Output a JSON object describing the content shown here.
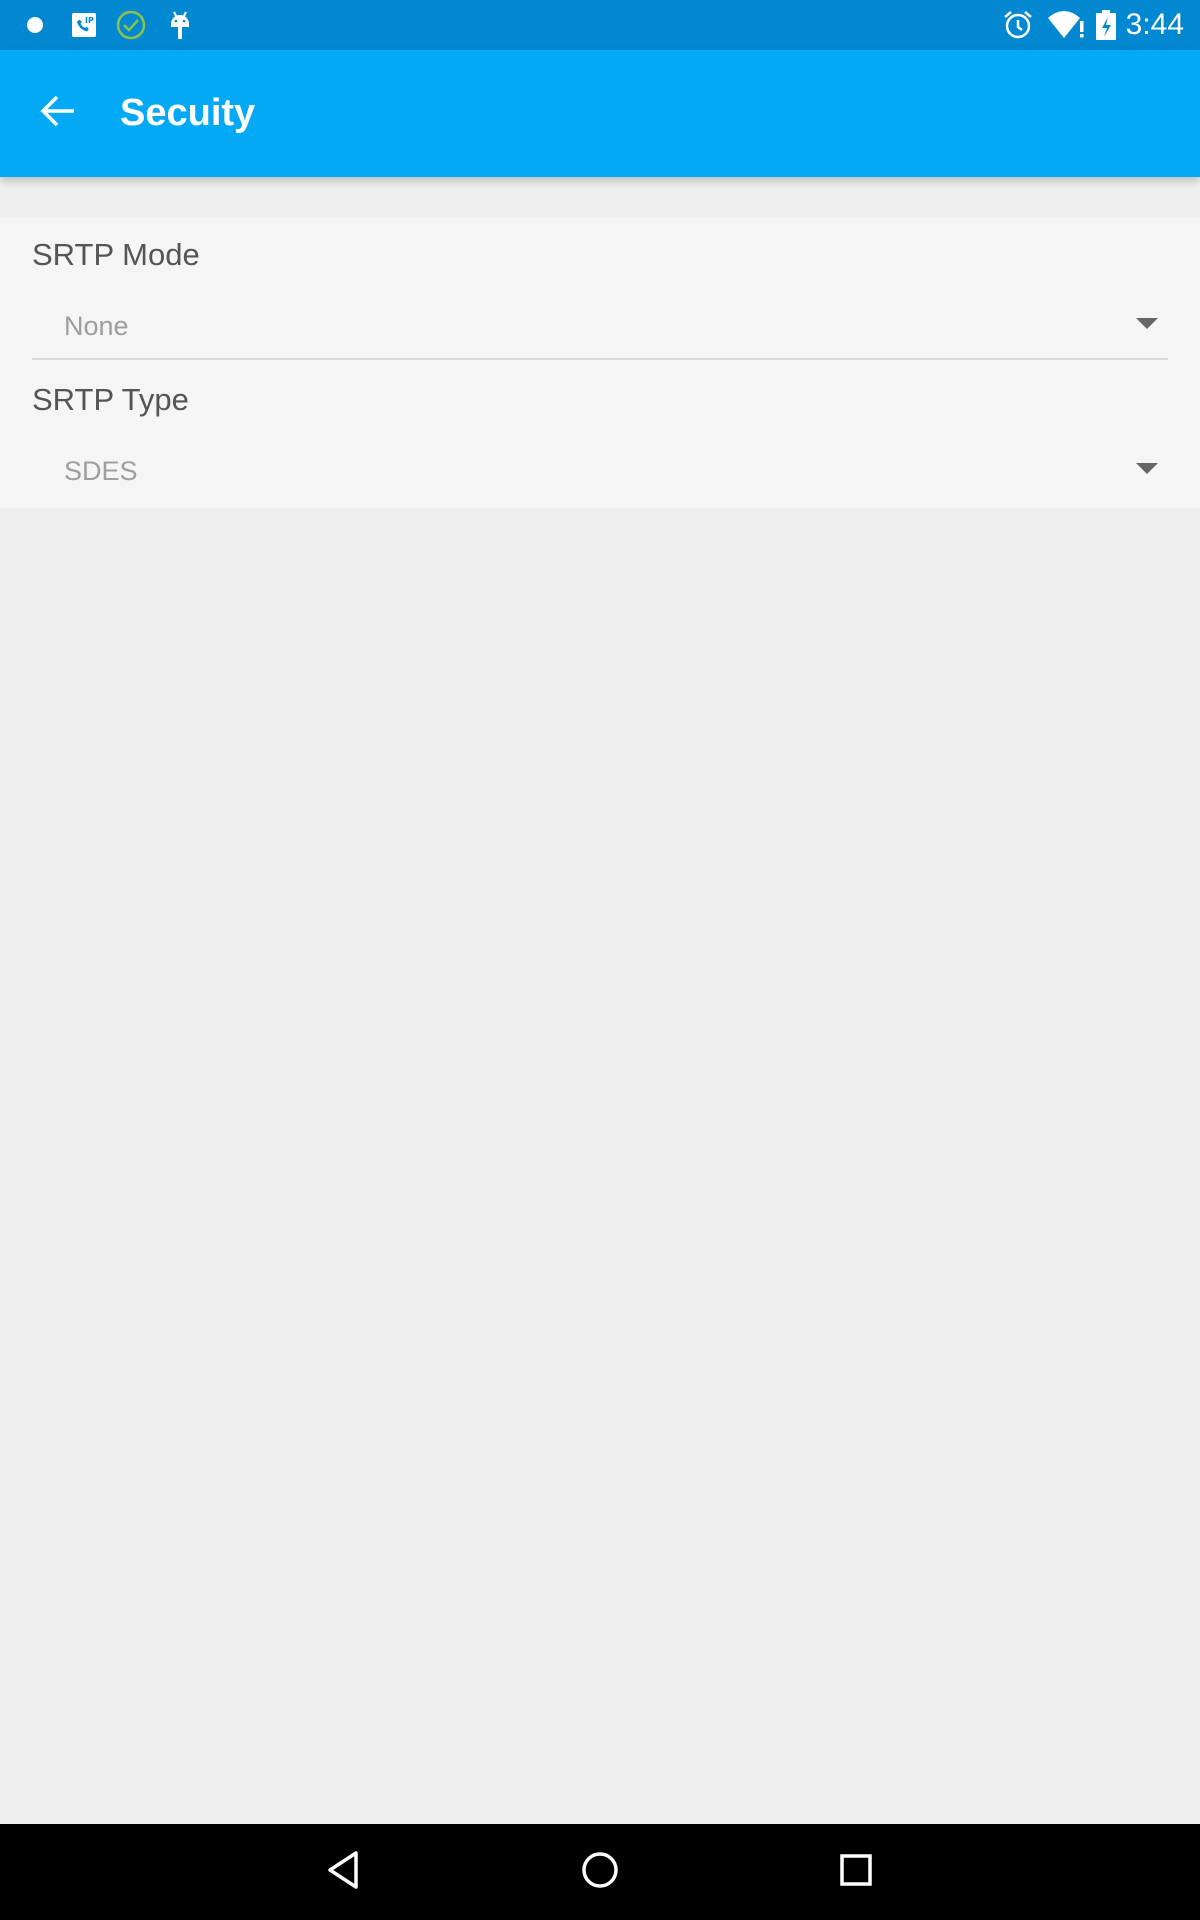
{
  "status_bar": {
    "time": "3:44",
    "left_icons": [
      "notification-dot-icon",
      "sip-phone-icon",
      "check-circle-icon",
      "android-debug-icon"
    ],
    "right_icons": [
      "alarm-icon",
      "wifi-icon",
      "battery-charging-icon"
    ],
    "accent_color": "#0288d1"
  },
  "app_bar": {
    "title": "Secuity",
    "back_icon": "arrow-back-icon",
    "color": "#03a9f4"
  },
  "preferences": [
    {
      "label": "SRTP Mode",
      "value": "None"
    },
    {
      "label": "SRTP Type",
      "value": "SDES"
    }
  ],
  "nav_bar": {
    "buttons": [
      "back-icon",
      "home-icon",
      "recents-icon"
    ]
  }
}
